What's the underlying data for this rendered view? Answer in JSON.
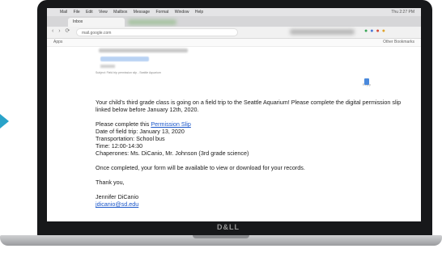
{
  "menubar": {
    "apple": "",
    "items": [
      "Mail",
      "File",
      "Edit",
      "View",
      "Mailbox",
      "Message",
      "Format",
      "Window",
      "Help"
    ],
    "clock": "Thu 2:27 PM"
  },
  "browser": {
    "tab_title": "Inbox",
    "url": "mail.google.com",
    "bookmarks_apps": "Apps",
    "bookmarks_other": "Other Bookmarks"
  },
  "email": {
    "attachment_line": "Subject: Field trip permission slip - Seattle Aquarium",
    "reply_label": "Reply",
    "paragraph1": "Your child’s third grade class is going on a field trip to the Seattle Aquarium! Please complete the digital permission slip linked below before January 12th, 2020.",
    "complete_prefix": "Please complete this ",
    "permission_link": "Permission Slip",
    "date_line": "Date of field trip: January 13, 2020",
    "transport_line": "Transportation: School bus",
    "time_line": "Time: 12:00-14:30",
    "chaperones_line": "Chaperones: Ms. DiCanio, Mr. Johnson (3rd grade science)",
    "completion_note": "Once completed, your form will be available to view or download for your records.",
    "signoff": "Thank you,",
    "sender_name": "Jennifer DiCanio",
    "sender_email": "jdicanio@sd.edu"
  },
  "laptop": {
    "brand": "D&LL"
  },
  "colors": {
    "accent": "#29a3c9",
    "link": "#1a56c9",
    "bezel": "#17181a"
  }
}
